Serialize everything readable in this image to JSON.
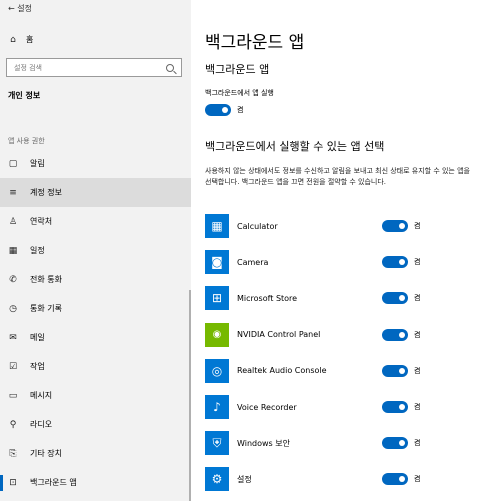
{
  "window": {
    "back_label": "← 설정"
  },
  "sidebar": {
    "home_label": "홈",
    "search_placeholder": "설정 검색",
    "section_title": "개인 정보",
    "group_label": "앱 사용 권한",
    "items": [
      {
        "label": "알림",
        "icon": "bell-icon",
        "glyph": "▢"
      },
      {
        "label": "계정 정보",
        "icon": "account-info-icon",
        "glyph": "≡"
      },
      {
        "label": "연락처",
        "icon": "contacts-icon",
        "glyph": "♙"
      },
      {
        "label": "일정",
        "icon": "calendar-icon",
        "glyph": "▦"
      },
      {
        "label": "전화 통화",
        "icon": "phone-icon",
        "glyph": "✆"
      },
      {
        "label": "통화 기록",
        "icon": "history-icon",
        "glyph": "◷"
      },
      {
        "label": "메일",
        "icon": "mail-icon",
        "glyph": "✉"
      },
      {
        "label": "작업",
        "icon": "tasks-icon",
        "glyph": "☑"
      },
      {
        "label": "메시지",
        "icon": "message-icon",
        "glyph": "▭"
      },
      {
        "label": "라디오",
        "icon": "radio-icon",
        "glyph": "⚲"
      },
      {
        "label": "기타 장치",
        "icon": "other-devices-icon",
        "glyph": "⎘"
      },
      {
        "label": "백그라운드 앱",
        "icon": "background-apps-icon",
        "glyph": "⊡"
      }
    ]
  },
  "main": {
    "page_title": "백그라운드 앱",
    "sub_title": "백그라운드 앱",
    "bg_toggle_label": "백그라운드에서 앱 실행",
    "bg_toggle_state": "켬",
    "select_title": "백그라운드에서 실행할 수 있는 앱 선택",
    "description": "사용하지 않는 상태에서도 정보를 수신하고 알림을 보내고 최신 상태로 유지할 수 있는 앱을 선택합니다. 백그라운드 앱을 끄면 전원을 절약할 수 있습니다.",
    "apps": [
      {
        "name": "Calculator",
        "state": "켬",
        "icon": "calculator-icon",
        "glyph": "▦"
      },
      {
        "name": "Camera",
        "state": "켬",
        "icon": "camera-icon",
        "glyph": "◙"
      },
      {
        "name": "Microsoft Store",
        "state": "켬",
        "icon": "store-icon",
        "glyph": "⊞"
      },
      {
        "name": "NVIDIA Control Panel",
        "state": "켬",
        "icon": "nvidia-icon",
        "glyph": "◉"
      },
      {
        "name": "Realtek Audio Console",
        "state": "켬",
        "icon": "audio-console-icon",
        "glyph": "◎"
      },
      {
        "name": "Voice Recorder",
        "state": "켬",
        "icon": "voice-recorder-icon",
        "glyph": "♪"
      },
      {
        "name": "Windows 보안",
        "state": "켬",
        "icon": "shield-icon",
        "glyph": "⛨"
      },
      {
        "name": "설정",
        "state": "켬",
        "icon": "settings-gear-icon",
        "glyph": "⚙"
      }
    ]
  },
  "colors": {
    "accent": "#0067c0",
    "sidebar_bg": "#f2f2f2",
    "app_tile": "#0078d4",
    "nvidia": "#76b900"
  }
}
